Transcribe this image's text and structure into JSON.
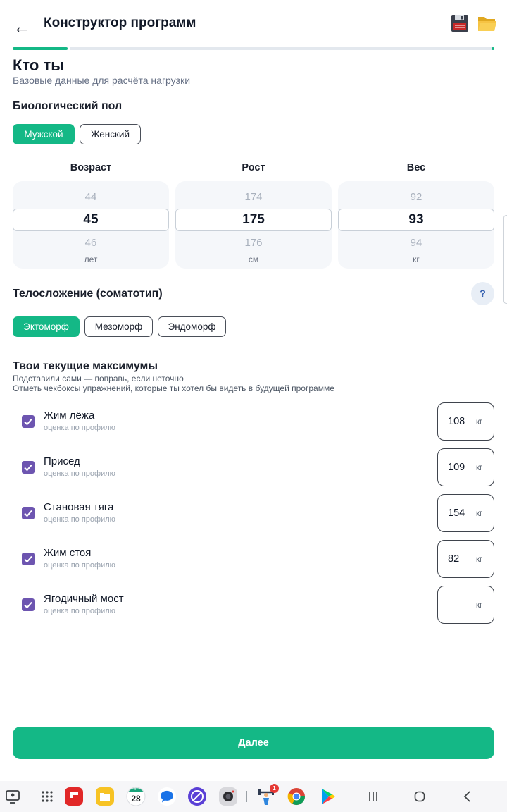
{
  "header": {
    "title": "Конструктор программ",
    "back_icon": "←"
  },
  "progress": {
    "step_fraction": 0.115
  },
  "step": {
    "title": "Кто ты",
    "subtitle": "Базовые данные для расчёта нагрузки"
  },
  "sex": {
    "label": "Биологический пол",
    "options": [
      "Мужской",
      "Женский"
    ],
    "selected": "Мужской"
  },
  "pickers": [
    {
      "label": "Возраст",
      "prev": "44",
      "value": "45",
      "next": "46",
      "unit": "лет"
    },
    {
      "label": "Рост",
      "prev": "174",
      "value": "175",
      "next": "176",
      "unit": "см"
    },
    {
      "label": "Вес",
      "prev": "92",
      "value": "93",
      "next": "94",
      "unit": "кг"
    }
  ],
  "somatotype": {
    "label": "Телосложение (соматотип)",
    "help": "?",
    "options": [
      "Эктоморф",
      "Мезоморф",
      "Эндоморф"
    ],
    "selected": "Эктоморф"
  },
  "maxes": {
    "title": "Твои текущие максимумы",
    "subtitle1": "Подставили сами — поправь, если неточно",
    "subtitle2": "Отметь чекбоксы упражнений, которые ты хотел бы видеть в будущей программе",
    "exercises": [
      {
        "name": "Жим лёжа",
        "hint": "оценка по профилю",
        "value": "108",
        "unit": "кг",
        "checked": true
      },
      {
        "name": "Присед",
        "hint": "оценка по профилю",
        "value": "109",
        "unit": "кг",
        "checked": true
      },
      {
        "name": "Становая тяга",
        "hint": "оценка по профилю",
        "value": "154",
        "unit": "кг",
        "checked": true
      },
      {
        "name": "Жим стоя",
        "hint": "оценка по профилю",
        "value": "82",
        "unit": "кг",
        "checked": true
      },
      {
        "name": "Ягодичный мост",
        "hint": "оценка по профилю",
        "value": "",
        "unit": "кг",
        "checked": true
      }
    ]
  },
  "next_button": "Далее",
  "taskbar": {
    "calendar_day": "28",
    "calendar_dow": "пт",
    "badge_count": "1",
    "apps": [
      "screen-icon",
      "apps-grid-icon",
      "flipboard-icon",
      "files-icon",
      "calendar-icon",
      "messages-icon",
      "browser-icon",
      "camera-icon",
      "fitness-icon",
      "chrome-icon",
      "play-store-icon"
    ]
  },
  "colors": {
    "accent": "#14b886",
    "checkbox": "#6d55b0",
    "help_bg": "#e8eef6"
  }
}
